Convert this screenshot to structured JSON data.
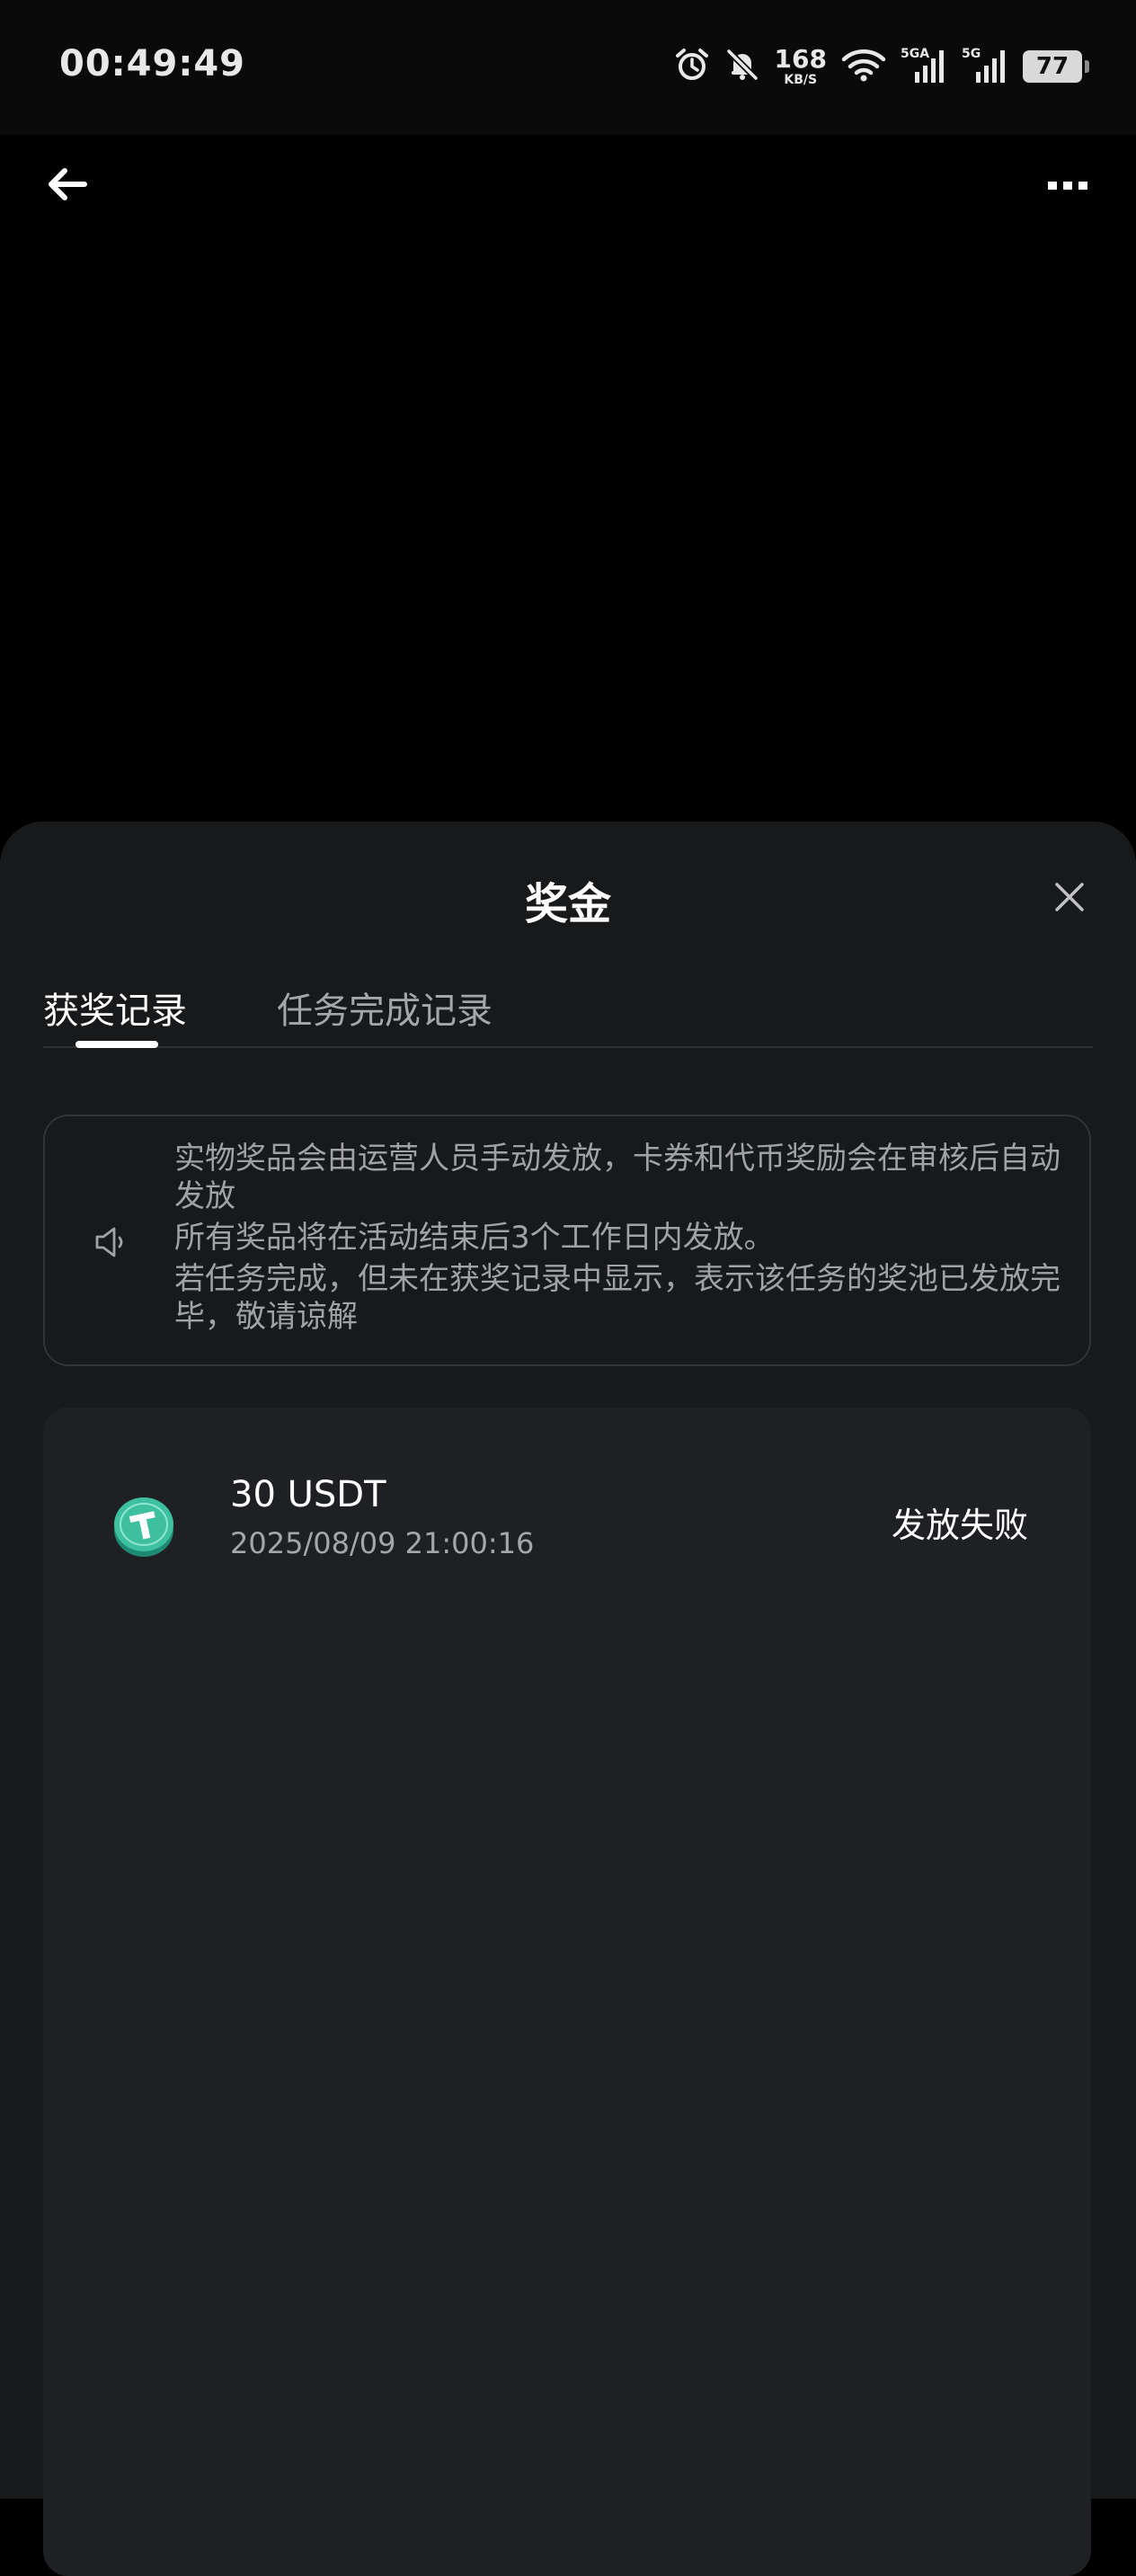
{
  "status_bar": {
    "time": "00:49:49",
    "net_speed": "168",
    "net_unit": "KB/S",
    "signal1_label": "5GA",
    "signal2_label": "5G",
    "battery": "77",
    "icons": [
      "alarm-icon",
      "mute-icon",
      "wifi-icon",
      "signal-5ga-icon",
      "signal-5g-icon",
      "battery-icon"
    ]
  },
  "nav": {
    "back_icon": "arrow-left-icon",
    "more_icon": "more-icon"
  },
  "sheet": {
    "title": "奖金",
    "close_icon": "close-icon",
    "tabs": [
      {
        "label": "获奖记录",
        "active": true
      },
      {
        "label": "任务完成记录",
        "active": false
      }
    ],
    "notice": {
      "icon": "speaker-icon",
      "lines": [
        "实物奖品会由运营人员手动发放，卡券和代币奖励会在审核后自动发放",
        "所有奖品将在活动结束后3个工作日内发放。",
        "若任务完成，但未在获奖记录中显示，表示该任务的奖池已发放完毕，敬请谅解"
      ]
    },
    "records": [
      {
        "icon": "usdt-coin-icon",
        "amount": "30 USDT",
        "time": "2025/08/09 21:00:16",
        "status": "发放失败"
      }
    ]
  },
  "colors": {
    "background": "#000000",
    "sheet": "#18191b",
    "card": "#1f2024",
    "coin": "#3ebfa0",
    "muted_text": "#a4a6ab"
  }
}
